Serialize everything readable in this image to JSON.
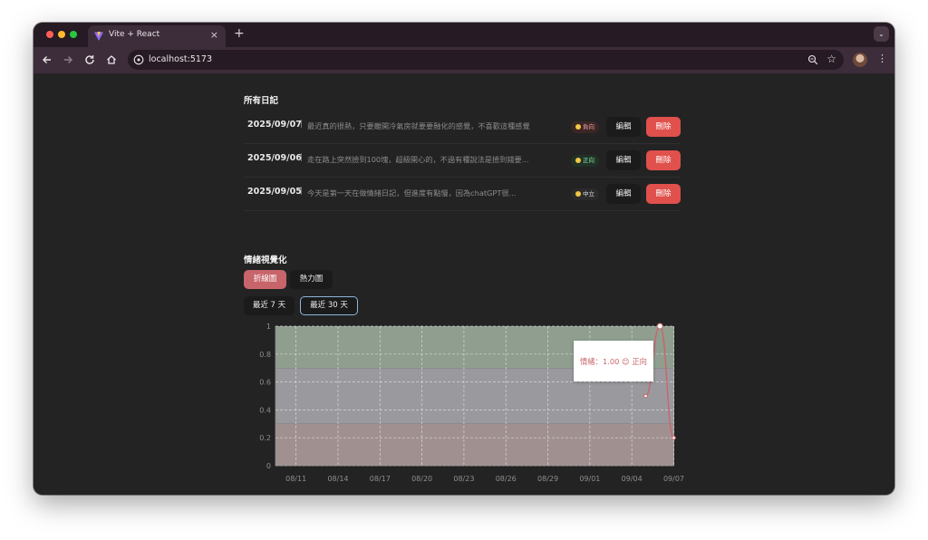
{
  "browser": {
    "tab_title": "Vite + React",
    "tab_close": "×",
    "new_tab": "+",
    "url": "localhost:5173",
    "star": "☆",
    "menu": "⋮",
    "tabmenu": "⌄"
  },
  "diary": {
    "title": "所有日記",
    "entries": [
      {
        "date": "2025/09/07",
        "sep": "|",
        "text": "最近真的很熱，只要離開冷氣房就要要融化的感覺，不喜歡這種感覺",
        "mood": "負向",
        "edit": "編輯",
        "delete": "刪除"
      },
      {
        "date": "2025/09/06",
        "sep": "|",
        "text": "走在路上突然撿到100塊，超級開心的，不過有種說法是撿到錢要...",
        "mood": "正向",
        "edit": "編輯",
        "delete": "刪除"
      },
      {
        "date": "2025/09/05",
        "sep": "|",
        "text": "今天是第一天在做情緒日記，但進度有點慢，因為chatGPT很...",
        "mood": "中立",
        "edit": "編輯",
        "delete": "刪除"
      }
    ]
  },
  "viz": {
    "title": "情緒視覺化",
    "tabs": {
      "line": "折線圖",
      "heatmap": "熱力圖"
    },
    "ranges": {
      "d7": "最近 7 天",
      "d30": "最近 30 天"
    }
  },
  "chart_data": {
    "type": "line",
    "x_ticks": [
      "08/11",
      "08/14",
      "08/17",
      "08/20",
      "08/23",
      "08/26",
      "08/29",
      "09/01",
      "09/04",
      "09/07"
    ],
    "y_ticks": [
      "0",
      "0.2",
      "0.4",
      "0.6",
      "0.8",
      "1"
    ],
    "ylim": [
      0,
      1
    ],
    "grid": true,
    "bands": [
      {
        "from": 0,
        "to": 0.3,
        "color": "#a09190"
      },
      {
        "from": 0.3,
        "to": 0.7,
        "color": "#9a9a9e"
      },
      {
        "from": 0.7,
        "to": 1,
        "color": "#8f9e8f"
      }
    ],
    "series": [
      {
        "x": [
          "09/05",
          "09/06",
          "09/07"
        ],
        "values": [
          0.5,
          1.0,
          0.2
        ],
        "color": "#c8656a"
      }
    ],
    "tooltip": {
      "label": "情緒：1.00 😊 正向"
    }
  }
}
